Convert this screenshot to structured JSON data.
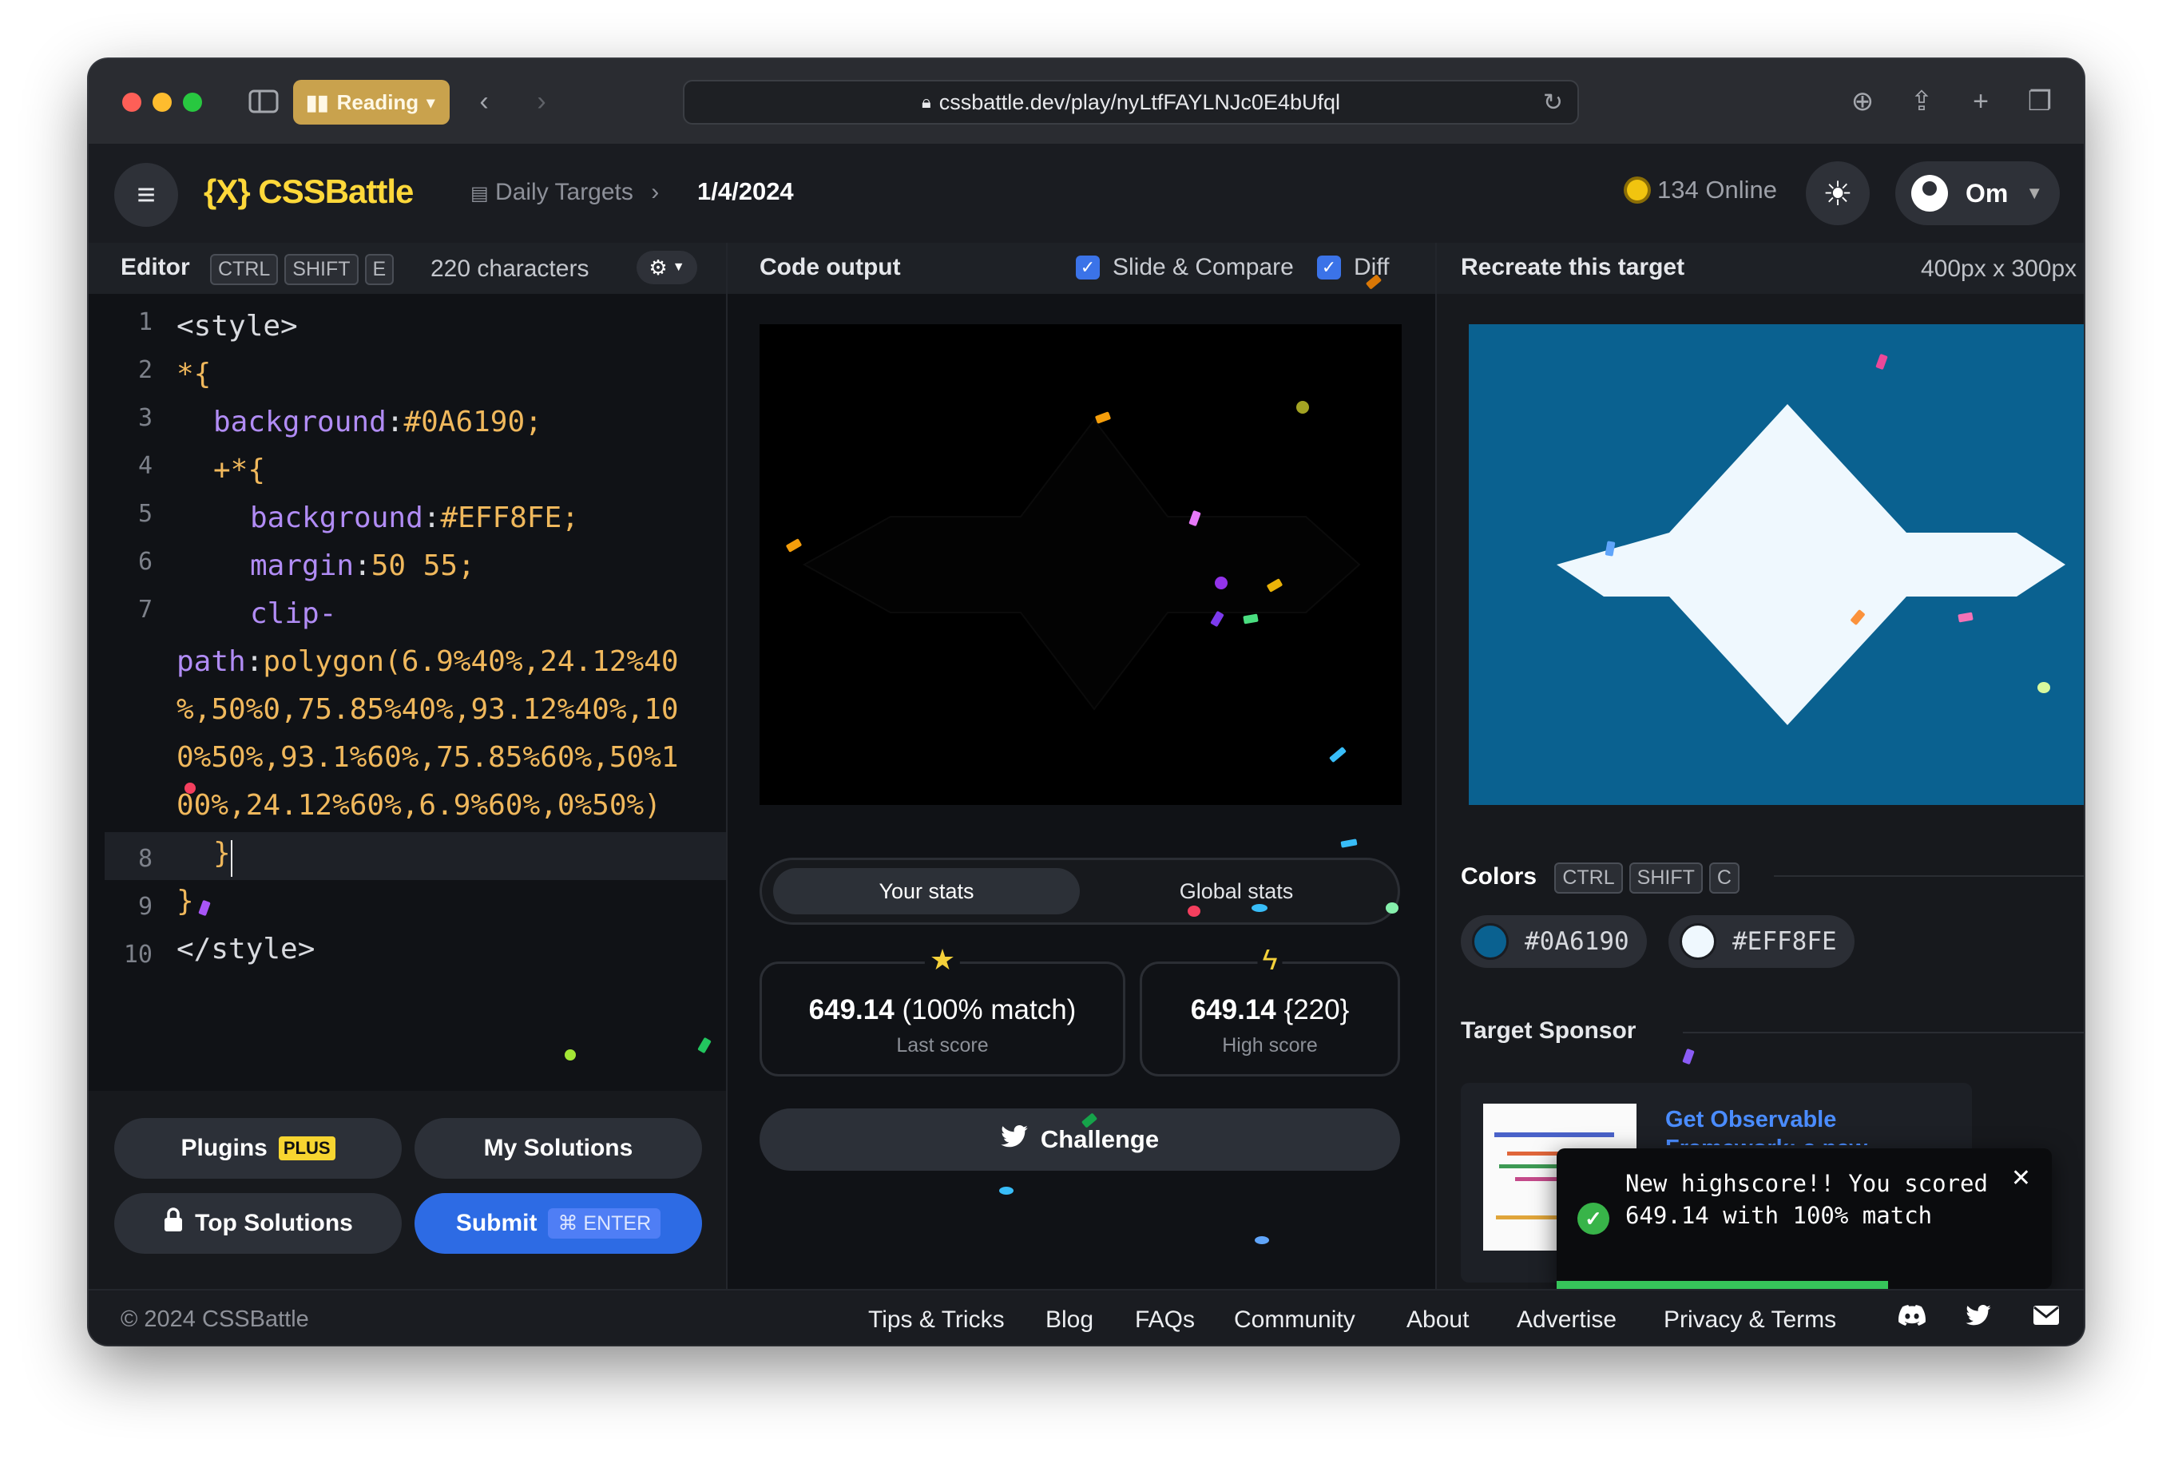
{
  "browser": {
    "reading_label": "Reading",
    "url": "cssbattle.dev/play/nyLtfFAYLNJc0E4bUfql"
  },
  "header": {
    "logo": "{X} CSSBattle",
    "breadcrumb_section": "Daily Targets",
    "breadcrumb_date": "1/4/2024",
    "online_count": "134 Online",
    "user_name": "Om"
  },
  "editor": {
    "title": "Editor",
    "shortcut": [
      "CTRL",
      "SHIFT",
      "E"
    ],
    "characters": "220 characters",
    "line_numbers": [
      "1",
      "2",
      "3",
      "4",
      "5",
      "6",
      "7",
      "8",
      "9",
      "10"
    ],
    "code": {
      "l1": "<style>",
      "l2": "*{",
      "l3_prop": "background",
      "l3_val": "#0A6190;",
      "l4": "+*{",
      "l5_prop": "background",
      "l5_val": "#EFF8FE;",
      "l6_prop": "margin",
      "l6_val": "50 55;",
      "l7a": "clip-",
      "l7b_prop": "path",
      "l7b_val": "polygon(6.9%40%,24.12%40",
      "l7c": "%,50%0,75.85%40%,93.12%40%,10",
      "l7d": "0%50%,93.1%60%,75.85%60%,50%1",
      "l7e": "00%,24.12%60%,6.9%60%,0%50%)",
      "l8": "}",
      "l9": "}",
      "l10": "</style>"
    }
  },
  "output": {
    "title": "Code output",
    "slide_compare": "Slide & Compare",
    "diff": "Diff"
  },
  "target": {
    "title": "Recreate this target",
    "size": "400px x 300px"
  },
  "stats": {
    "tab_yours": "Your stats",
    "tab_global": "Global stats",
    "last_score": "649.14",
    "last_match": "(100% match)",
    "last_label": "Last score",
    "high_score": "649.14",
    "high_chars": "{220}",
    "high_label": "High score"
  },
  "actions": {
    "challenge": "Challenge",
    "plugins": "Plugins",
    "plus_badge": "PLUS",
    "my_solutions": "My Solutions",
    "top_solutions": "Top Solutions",
    "submit": "Submit",
    "submit_shortcut": "⌘ ENTER"
  },
  "colors": {
    "title": "Colors",
    "shortcut": [
      "CTRL",
      "SHIFT",
      "C"
    ],
    "swatches": [
      {
        "hex": "#0A6190",
        "color": "#0A6190"
      },
      {
        "hex": "#EFF8FE",
        "color": "#EFF8FE"
      }
    ]
  },
  "sponsor": {
    "title": "Target Sponsor",
    "link": "Get Observable Framework: a new"
  },
  "toast": {
    "message": "New highscore!! You scored 649.14 with 100% match",
    "progress": 0.67
  },
  "footer": {
    "copyright": "© 2024 CSSBattle",
    "links": [
      "Tips & Tricks",
      "Blog",
      "FAQs",
      "Community",
      "About",
      "Advertise",
      "Privacy & Terms"
    ]
  },
  "theme": {
    "accent_yellow": "#ffd83a",
    "submit_blue": "#2d6be4",
    "target_bg": "#0A6190",
    "target_fg": "#EFF8FE"
  }
}
